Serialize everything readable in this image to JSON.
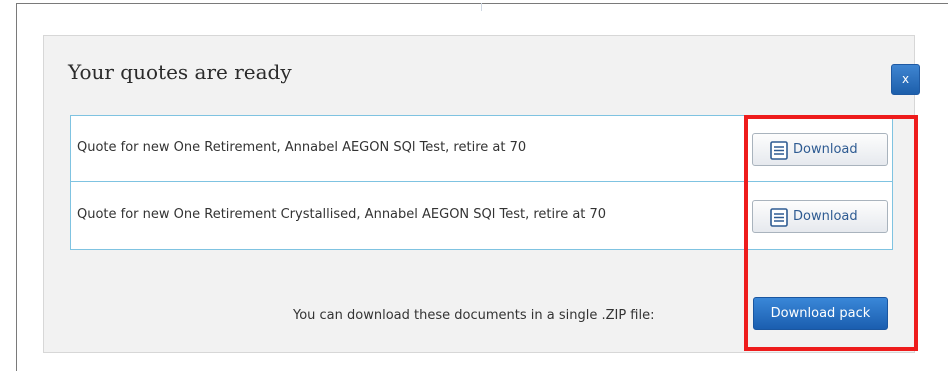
{
  "modal": {
    "title": "Your quotes are ready",
    "close_label": "x",
    "quotes": [
      {
        "description": "Quote for new One Retirement, Annabel AEGON SQl Test, retire at 70",
        "download_label": "Download"
      },
      {
        "description": "Quote for new One Retirement Crystallised, Annabel AEGON SQl Test, retire at 70",
        "download_label": "Download"
      }
    ],
    "zip_message": "You can download these documents in a single .ZIP file:",
    "download_pack_label": "Download pack"
  },
  "icons": {
    "close": "close-icon",
    "document": "document-icon"
  },
  "colors": {
    "primary_button": "#1f5fae",
    "list_border": "#7fc3e1",
    "highlight": "#ee1c1c",
    "modal_background": "#f2f2f2"
  }
}
